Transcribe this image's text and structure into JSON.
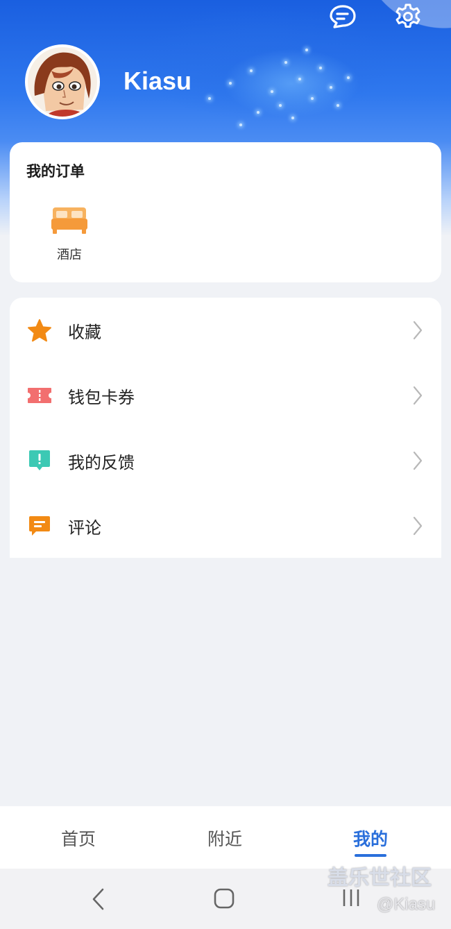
{
  "profile": {
    "username": "Kiasu"
  },
  "header_actions": {
    "message_icon": "message-icon",
    "settings_icon": "gear-icon"
  },
  "orders": {
    "title": "我的订单",
    "items": [
      {
        "label": "酒店",
        "icon": "bed-icon"
      }
    ]
  },
  "menu": {
    "items": [
      {
        "label": "收藏",
        "icon": "star-icon",
        "color": "#f28a14"
      },
      {
        "label": "钱包卡券",
        "icon": "ticket-icon",
        "color": "#f26f6f"
      },
      {
        "label": "我的反馈",
        "icon": "feedback-icon",
        "color": "#3cc9b4"
      },
      {
        "label": "评论",
        "icon": "comment-icon",
        "color": "#f28a14"
      }
    ]
  },
  "tabbar": {
    "tabs": [
      {
        "label": "首页",
        "active": false
      },
      {
        "label": "附近",
        "active": false
      },
      {
        "label": "我的",
        "active": true
      }
    ],
    "active_color": "#2a6fdb"
  },
  "watermark": {
    "line1": "盖乐世社区",
    "line2": "@Kiasu"
  },
  "system_nav": {
    "back_icon": "back-icon",
    "home_icon": "home-icon",
    "recents_icon": "recents-icon"
  }
}
